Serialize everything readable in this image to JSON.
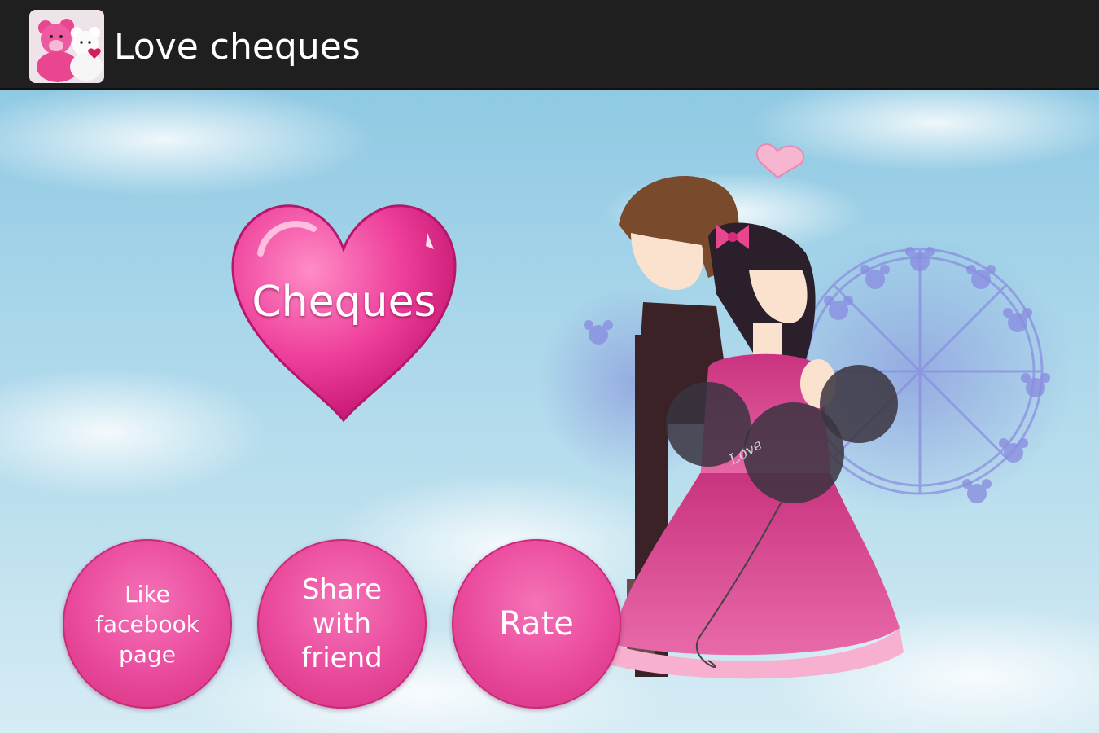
{
  "action_bar": {
    "title": "Love cheques",
    "icon": "teddy-bears-app-icon"
  },
  "main": {
    "heart_button_label": "Cheques",
    "buttons": {
      "like": {
        "label_lines": [
          "Like",
          "facebook",
          "page"
        ]
      },
      "share": {
        "label_lines": [
          "Share",
          "with",
          "friend"
        ]
      },
      "rate": {
        "label": "Rate"
      }
    },
    "balloon_text": "Love"
  },
  "colors": {
    "action_bar": "#1f1f1f",
    "sky": "#a9d6ea",
    "pink_accent": "#ea4a9c",
    "heart": "#e83f95"
  }
}
